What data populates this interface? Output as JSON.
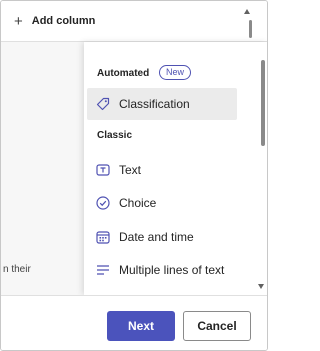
{
  "top_bar": {
    "add_column_label": "Add column",
    "plus_icon": "+"
  },
  "left_pane": {
    "partial_text": "n their"
  },
  "menu": {
    "sections": [
      {
        "heading": "Automated",
        "badge": "New"
      },
      {
        "heading": "Classic"
      }
    ],
    "items": [
      {
        "label": "Classification",
        "icon": "tag-icon",
        "selected": true
      },
      {
        "label": "Text",
        "icon": "text-box-icon"
      },
      {
        "label": "Choice",
        "icon": "check-circle-icon"
      },
      {
        "label": "Date and time",
        "icon": "calendar-icon"
      },
      {
        "label": "Multiple lines of text",
        "icon": "multiline-text-icon"
      }
    ]
  },
  "footer": {
    "next_label": "Next",
    "cancel_label": "Cancel"
  },
  "colors": {
    "accent": "#4b53bc",
    "selected_bg": "#ebebeb",
    "icon": "#4f52b2"
  }
}
